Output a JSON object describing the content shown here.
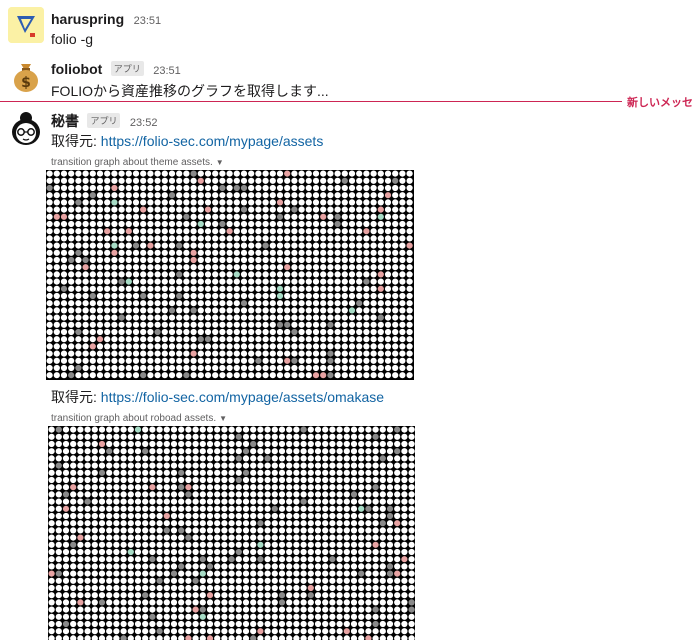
{
  "messages": [
    {
      "user": "haruspring",
      "time": "23:51",
      "text": "folio -g"
    },
    {
      "user": "foliobot",
      "badge": "アプリ",
      "time": "23:51",
      "text": "FOLIOから資産推移のグラフを取得します..."
    },
    {
      "user": "秘書",
      "badge": "アプリ",
      "time": "23:52",
      "source1_label": "取得元: ",
      "source1_url": "https://folio-sec.com/mypage/assets",
      "caption1": "transition graph about theme assets.",
      "source2_label": "取得元: ",
      "source2_url": "https://folio-sec.com/mypage/assets/omakase",
      "caption2": "transition graph about roboad assets."
    }
  ],
  "new_messages_label": "新しいメッセ",
  "colors": {
    "link": "#1264a3",
    "new_divider": "#cd2553",
    "graph_bg": "#000000",
    "graph_dot": "#ffffff"
  }
}
